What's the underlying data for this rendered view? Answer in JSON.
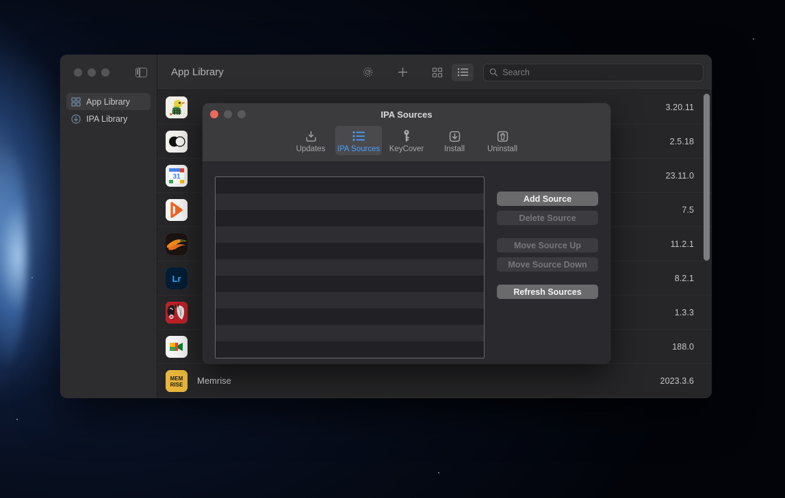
{
  "desktop": {
    "wallpaper": "earth-from-space-dark"
  },
  "main_window": {
    "title": "App Library",
    "traffic_lights": [
      "close",
      "minimize",
      "zoom"
    ],
    "sidebar_toggle_icon": "sidebar-toggle-icon",
    "sidebar": {
      "items": [
        {
          "label": "App Library",
          "icon": "grid-icon",
          "selected": true
        },
        {
          "label": "IPA Library",
          "icon": "download-circle-icon",
          "selected": false
        }
      ]
    },
    "toolbar": {
      "settings_icon": "gear-icon",
      "add_icon": "plus-icon",
      "grid_view_icon": "grid-view-icon",
      "list_view_icon": "list-view-icon",
      "active_view": "list",
      "search": {
        "placeholder": "Search",
        "value": "",
        "icon": "search-icon"
      }
    },
    "app_list": {
      "rows": [
        {
          "name": "",
          "version": "3.20.11",
          "icon": "duckduckgo-icon"
        },
        {
          "name": "",
          "version": "2.5.18",
          "icon": "halide-icon"
        },
        {
          "name": "",
          "version": "23.11.0",
          "icon": "google-calendar-icon"
        },
        {
          "name": "",
          "version": "7.5",
          "icon": "kmplayer-icon"
        },
        {
          "name": "",
          "version": "11.2.1",
          "icon": "lightroom-cc-icon"
        },
        {
          "name": "",
          "version": "8.2.1",
          "icon": "lightroom-icon"
        },
        {
          "name": "",
          "version": "1.3.3",
          "icon": "ladybug-game-icon"
        },
        {
          "name": "",
          "version": "188.0",
          "icon": "google-meet-icon"
        },
        {
          "name": "Memrise",
          "version": "2023.3.6",
          "icon": "memrise-icon"
        }
      ]
    },
    "scrollbar": {
      "visible": true
    }
  },
  "ipa_dialog": {
    "title": "IPA Sources",
    "traffic_lights": [
      "close",
      "minimize",
      "zoom"
    ],
    "tabs": [
      {
        "label": "Updates",
        "icon": "download-box-icon",
        "selected": false
      },
      {
        "label": "IPA Sources",
        "icon": "bullet-list-icon",
        "selected": true
      },
      {
        "label": "KeyCover",
        "icon": "key-icon",
        "selected": false
      },
      {
        "label": "Install",
        "icon": "install-down-icon",
        "selected": false
      },
      {
        "label": "Uninstall",
        "icon": "trash-icon",
        "selected": false
      }
    ],
    "sources_list": {
      "items": [],
      "row_count": 11
    },
    "buttons": [
      {
        "label": "Add Source",
        "enabled": true
      },
      {
        "label": "Delete Source",
        "enabled": false
      },
      {
        "label": "Move Source Up",
        "enabled": false
      },
      {
        "label": "Move Source Down",
        "enabled": false
      },
      {
        "label": "Refresh Sources",
        "enabled": true
      }
    ]
  },
  "colors": {
    "accent": "#4a9eff",
    "window_chrome": "#2d2d2f",
    "content_bg": "#262628",
    "dialog_bg": "#2a2a2e",
    "dialog_chrome": "#3b3b3d",
    "close_red": "#ec6a5e"
  }
}
